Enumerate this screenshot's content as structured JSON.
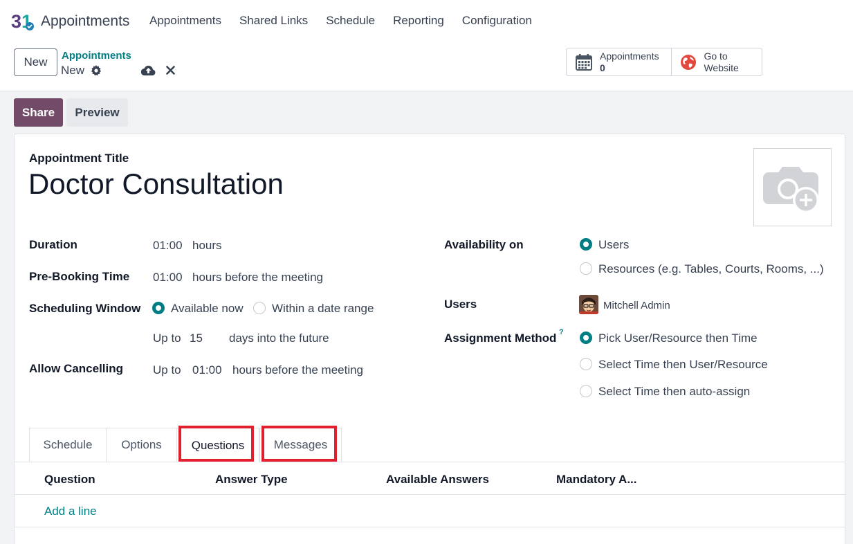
{
  "navbar": {
    "app_name": "Appointments",
    "logo_icon": "calendar-31-icon",
    "menu": [
      "Appointments",
      "Shared Links",
      "Schedule",
      "Reporting",
      "Configuration"
    ]
  },
  "control_panel": {
    "new_label": "New",
    "breadcrumb_parent": "Appointments",
    "breadcrumb_current": "New",
    "icons": [
      "gear-icon",
      "cloud-upload-icon",
      "close-icon"
    ],
    "smart_buttons": [
      {
        "label": "Appointments",
        "value": "0",
        "icon": "calendar-icon"
      },
      {
        "label_line1": "Go to",
        "label_line2": "Website",
        "icon": "globe-icon"
      }
    ]
  },
  "actions": {
    "share_label": "Share",
    "preview_label": "Preview"
  },
  "form": {
    "title_label": "Appointment Title",
    "title_value": "Doctor Consultation",
    "duration": {
      "label": "Duration",
      "value": "01:00",
      "unit": "hours"
    },
    "pre_booking": {
      "label": "Pre-Booking Time",
      "value": "01:00",
      "unit": "hours before the meeting"
    },
    "scheduling_window": {
      "label": "Scheduling Window",
      "options": [
        "Available now",
        "Within a date range"
      ],
      "selected": "Available now",
      "up_to": "Up to",
      "days_value": "15",
      "days_unit": "days into the future"
    },
    "allow_cancelling": {
      "label": "Allow Cancelling",
      "up_to": "Up to",
      "value": "01:00",
      "unit": "hours before the meeting"
    },
    "availability_on": {
      "label": "Availability on",
      "options": [
        "Users",
        "Resources (e.g. Tables, Courts, Rooms, ...)"
      ],
      "selected": "Users"
    },
    "users": {
      "label": "Users",
      "value": "Mitchell Admin"
    },
    "assignment_method": {
      "label": "Assignment Method",
      "help": "?",
      "options": [
        "Pick User/Resource then Time",
        "Select Time then User/Resource",
        "Select Time then auto-assign"
      ],
      "selected": "Pick User/Resource then Time"
    }
  },
  "tabs": {
    "items": [
      "Schedule",
      "Options",
      "Questions",
      "Messages"
    ],
    "active": "Questions",
    "highlighted": [
      "Questions",
      "Messages"
    ],
    "highlight_color": "#e0202e"
  },
  "questions_table": {
    "columns": [
      "Question",
      "Answer Type",
      "Available Answers",
      "Mandatory A..."
    ],
    "add_line": "Add a line"
  },
  "colors": {
    "brand": "#714b67",
    "accent": "#017e84"
  }
}
